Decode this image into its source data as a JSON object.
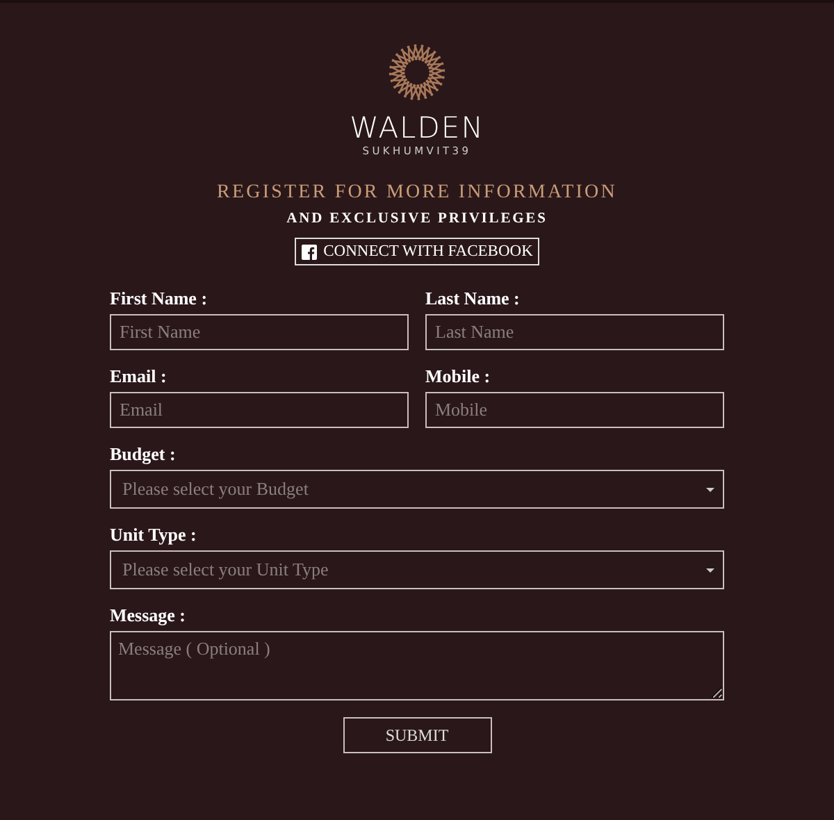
{
  "brand": {
    "name": "WALDEN",
    "tagline": "SUKHUMVIT39"
  },
  "heading": {
    "title": "REGISTER FOR MORE INFORMATION",
    "subtitle": "AND EXCLUSIVE PRIVILEGES"
  },
  "facebook_button": {
    "label": "CONNECT WITH FACEBOOK"
  },
  "form_rows": [
    [
      {
        "label": "First Name :",
        "kind": "text",
        "placeholder": "First Name"
      },
      {
        "label": "Last Name :",
        "kind": "text",
        "placeholder": "Last Name"
      }
    ],
    [
      {
        "label": "Email :",
        "kind": "text",
        "placeholder": "Email"
      },
      {
        "label": "Mobile :",
        "kind": "text",
        "placeholder": "Mobile"
      }
    ],
    [
      {
        "label": "Budget :",
        "kind": "select",
        "placeholder": "Please select your Budget"
      }
    ],
    [
      {
        "label": "Unit Type :",
        "kind": "select",
        "placeholder": "Please select your Unit Type"
      }
    ],
    [
      {
        "label": "Message :",
        "kind": "textarea",
        "placeholder": "Message ( Optional )"
      }
    ]
  ],
  "submit_button": {
    "label": "SUBMIT"
  }
}
